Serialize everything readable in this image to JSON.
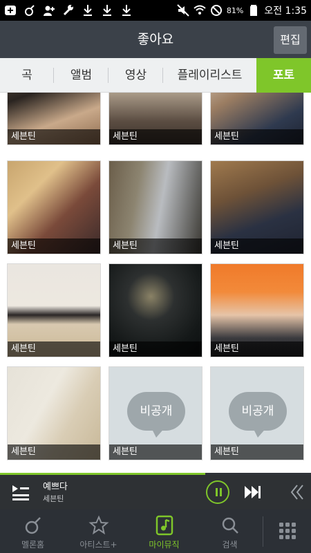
{
  "status_bar": {
    "battery": "81%",
    "time": "오전 1:35"
  },
  "header": {
    "title": "좋아요",
    "edit_label": "편집"
  },
  "tabs": [
    {
      "label": "곡"
    },
    {
      "label": "앨범"
    },
    {
      "label": "영상"
    },
    {
      "label": "플레이리스트"
    },
    {
      "label": "포토",
      "active": true
    }
  ],
  "photos": [
    {
      "caption": "세븐틴"
    },
    {
      "caption": "세븐틴"
    },
    {
      "caption": "세븐틴"
    },
    {
      "caption": "세븐틴"
    },
    {
      "caption": "세븐틴"
    },
    {
      "caption": "세븐틴"
    },
    {
      "caption": "세븐틴"
    },
    {
      "caption": "세븐틴"
    },
    {
      "caption": "세븐틴"
    },
    {
      "caption": "세븐틴"
    },
    {
      "caption": "세븐틴",
      "private": "비공개"
    },
    {
      "caption": "세븐틴",
      "private": "비공개"
    }
  ],
  "player": {
    "song_title": "예쁘다",
    "artist": "세븐틴",
    "progress": 0.66
  },
  "bottom_nav": [
    {
      "label": "멜론홈",
      "icon": "melon-home-icon"
    },
    {
      "label": "아티스트+",
      "icon": "star-icon"
    },
    {
      "label": "마이뮤직",
      "icon": "music-note-icon",
      "active": true
    },
    {
      "label": "검색",
      "icon": "search-icon"
    }
  ],
  "colors": {
    "accent": "#7fc62a",
    "header": "#3b4149",
    "nav": "#2c3036"
  }
}
